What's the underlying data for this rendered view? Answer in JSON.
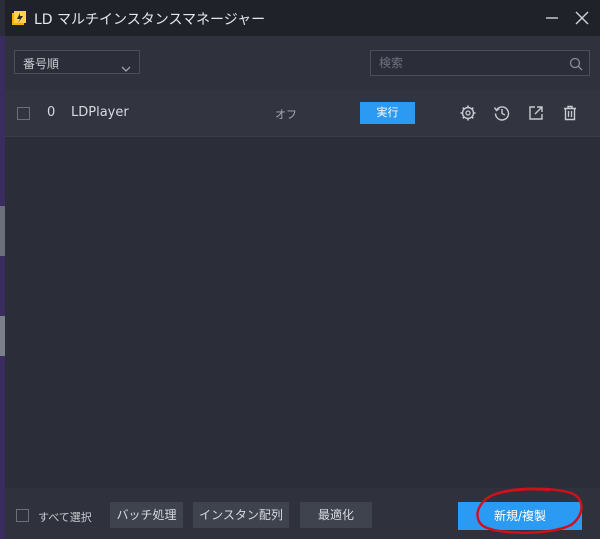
{
  "window": {
    "title": "LD マルチインスタンスマネージャー",
    "icons": {
      "app": "ldplayer-app-icon",
      "minimize": "minimize-icon",
      "close": "close-icon"
    }
  },
  "toolbar": {
    "sort_value": "番号順",
    "search_placeholder": "検索"
  },
  "instances": [
    {
      "index": "0",
      "name": "LDPlayer",
      "status": "オフ",
      "run_label": "実行",
      "actions": [
        "settings-icon",
        "history-restore-icon",
        "shortcut-export-icon",
        "delete-trash-icon"
      ]
    }
  ],
  "footer": {
    "select_all_label": "すべて選択",
    "batch_label": "バッチ処理",
    "arrange_label": "インスタン配列",
    "optimize_label": "最適化",
    "new_clone_label": "新規/複製"
  },
  "colors": {
    "accent": "#2b9af3",
    "titlebar": "#1f2229",
    "background": "#2b2e38",
    "annotation": "#d0101a"
  }
}
